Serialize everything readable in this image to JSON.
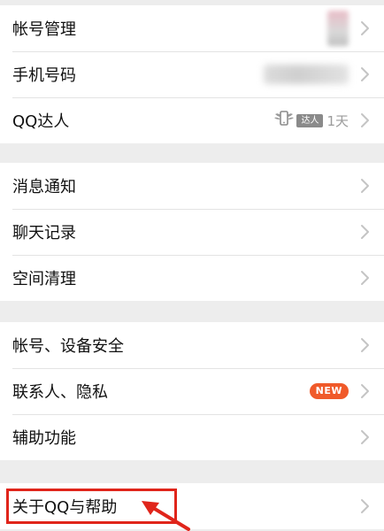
{
  "groups": [
    {
      "items": [
        {
          "label": "帐号管理"
        },
        {
          "label": "手机号码"
        },
        {
          "label": "QQ达人",
          "badge": "达人",
          "value": "1天"
        }
      ]
    },
    {
      "items": [
        {
          "label": "消息通知"
        },
        {
          "label": "聊天记录"
        },
        {
          "label": "空间清理"
        }
      ]
    },
    {
      "items": [
        {
          "label": "帐号、设备安全"
        },
        {
          "label": "联系人、隐私",
          "badge": "NEW"
        },
        {
          "label": "辅助功能"
        }
      ]
    },
    {
      "items": [
        {
          "label": "关于QQ与帮助"
        }
      ]
    }
  ],
  "icons": {
    "row_chevron": "chevron-right-icon",
    "daren": "phone-with-wings-icon"
  },
  "colors": {
    "new_badge": "#f05a2a",
    "highlight_box": "#e0251b",
    "background": "#ededed"
  }
}
